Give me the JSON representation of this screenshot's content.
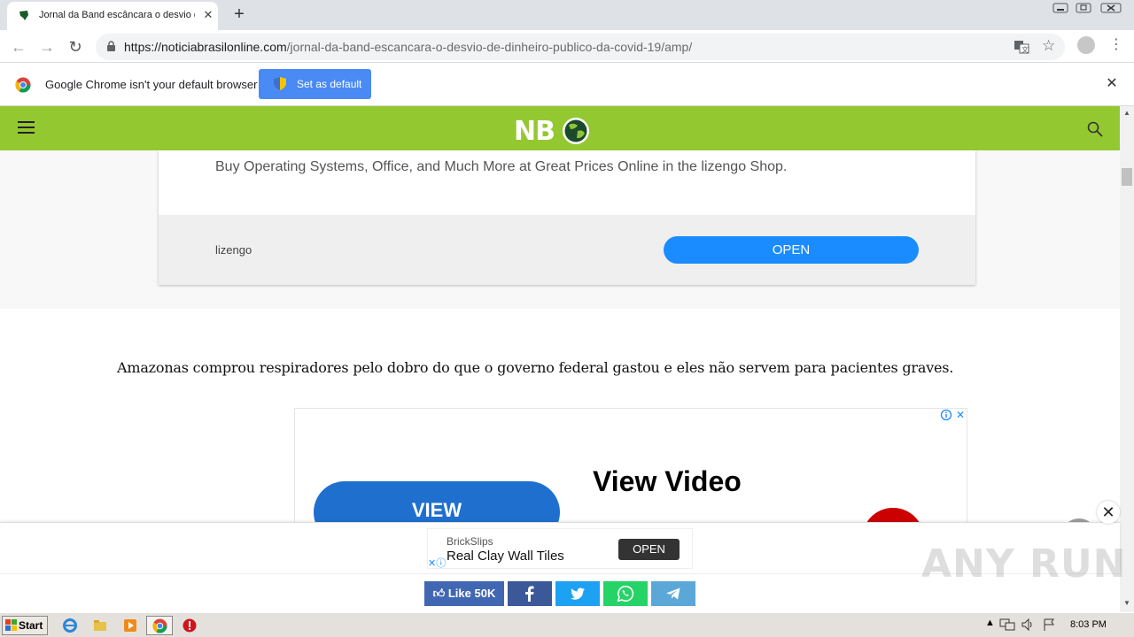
{
  "browser": {
    "tab_title": "Jornal da Band escâncara o desvio d",
    "url_host": "https://noticiabrasilonline.com",
    "url_path": "/jornal-da-band-escancara-o-desvio-de-dinheiro-publico-da-covid-19/amp/",
    "tab_close": "✕",
    "new_tab": "+"
  },
  "infobar": {
    "message": "Google Chrome isn't your default browser",
    "button_label": "Set as default",
    "close": "✕"
  },
  "site": {
    "logo": "NB"
  },
  "ad_card": {
    "description": "Buy Operating Systems, Office, and Much More at Great Prices Online in the lizengo Shop.",
    "brand": "lizengo",
    "cta": "OPEN"
  },
  "article": {
    "text": "Amazonas comprou respiradores pelo dobro do que o governo federal gastou e eles não servem para pacientes graves."
  },
  "video_ad": {
    "button": "VIEW",
    "heading": "View Video"
  },
  "sticky_ad": {
    "advertiser": "BrickSlips",
    "title": "Real Clay Wall Tiles",
    "cta": "OPEN",
    "close": "✕"
  },
  "share": {
    "like_label": "Like 50K"
  },
  "watermark": "ANY RUN",
  "taskbar": {
    "start": "Start",
    "clock": "8:03 PM"
  },
  "colors": {
    "site_header": "#94c831",
    "ad_cta": "#1a8cff",
    "set_default": "#4a8af4"
  }
}
